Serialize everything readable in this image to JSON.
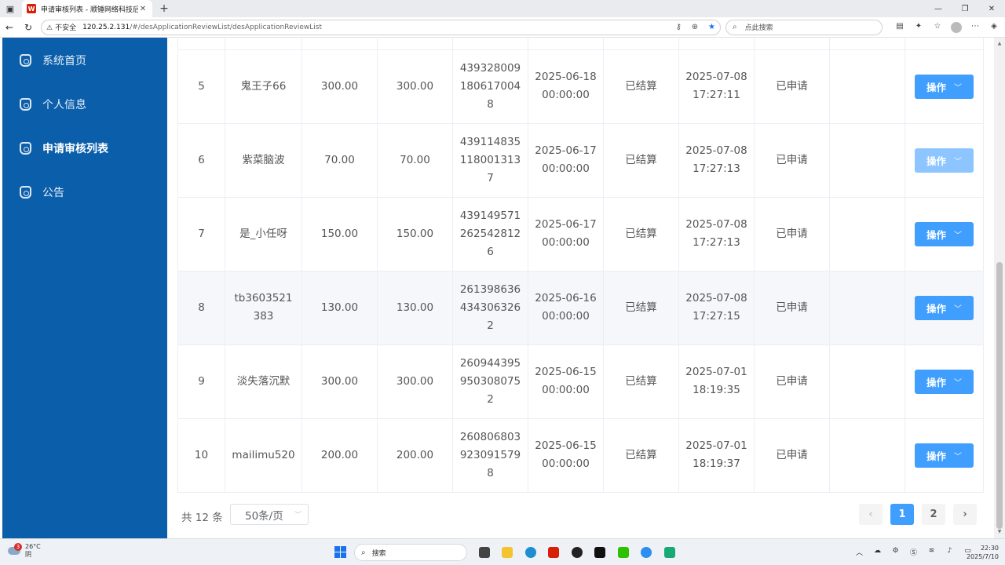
{
  "browser": {
    "tab_title": "申请审核列表 - 顺锤网络科技后台",
    "favicon_letter": "W",
    "insecure_label": "不安全",
    "url_host": "120.25.2.131",
    "url_path": "/#/desApplicationReviewList/desApplicationReviewList",
    "search_placeholder": "点此搜索"
  },
  "sidebar": {
    "items": [
      {
        "label": "系统首页"
      },
      {
        "label": "个人信息"
      },
      {
        "label": "申请审核列表"
      },
      {
        "label": "公告"
      }
    ]
  },
  "table": {
    "action_label": "操作",
    "rows": [
      {
        "index": "5",
        "user": "鬼王子66",
        "amount1": "300.00",
        "amount2": "300.00",
        "order_no": "4393280091806170048",
        "order_date": "2025-06-18",
        "order_time": "00:00:00",
        "settle": "已结算",
        "apply_date": "2025-07-08",
        "apply_time": "17:27:11",
        "status": "已申请"
      },
      {
        "index": "6",
        "user": "紫菜脑波",
        "amount1": "70.00",
        "amount2": "70.00",
        "order_no": "4391148351180013137",
        "order_date": "2025-06-17",
        "order_time": "00:00:00",
        "settle": "已结算",
        "apply_date": "2025-07-08",
        "apply_time": "17:27:13",
        "status": "已申请"
      },
      {
        "index": "7",
        "user": "是_小任呀",
        "amount1": "150.00",
        "amount2": "150.00",
        "order_no": "4391495712625428126",
        "order_date": "2025-06-17",
        "order_time": "00:00:00",
        "settle": "已结算",
        "apply_date": "2025-07-08",
        "apply_time": "17:27:13",
        "status": "已申请"
      },
      {
        "index": "8",
        "user": "tb3603521383",
        "amount1": "130.00",
        "amount2": "130.00",
        "order_no": "2613986364343063262",
        "order_date": "2025-06-16",
        "order_time": "00:00:00",
        "settle": "已结算",
        "apply_date": "2025-07-08",
        "apply_time": "17:27:15",
        "status": "已申请"
      },
      {
        "index": "9",
        "user": "淡失落沉默",
        "amount1": "300.00",
        "amount2": "300.00",
        "order_no": "2609443959503080752",
        "order_date": "2025-06-15",
        "order_time": "00:00:00",
        "settle": "已结算",
        "apply_date": "2025-07-01",
        "apply_time": "18:19:35",
        "status": "已申请"
      },
      {
        "index": "10",
        "user": "mailimu520",
        "amount1": "200.00",
        "amount2": "200.00",
        "order_no": "2608068039230915798",
        "order_date": "2025-06-15",
        "order_time": "00:00:00",
        "settle": "已结算",
        "apply_date": "2025-07-01",
        "apply_time": "18:19:37",
        "status": "已申请"
      }
    ]
  },
  "pagination": {
    "total": "共 12 条",
    "page_size": "50条/页",
    "pages": [
      "1",
      "2"
    ],
    "current": "1"
  },
  "taskbar": {
    "weather_temp": "26°C",
    "weather_desc": "阴",
    "weather_badge": "3",
    "search_label": "搜索",
    "time": "22:30",
    "date": "2025/7/10"
  },
  "colors": {
    "sidebar_bg": "#0b5eaa",
    "primary": "#409eff",
    "primary_light": "#8cc5ff"
  }
}
